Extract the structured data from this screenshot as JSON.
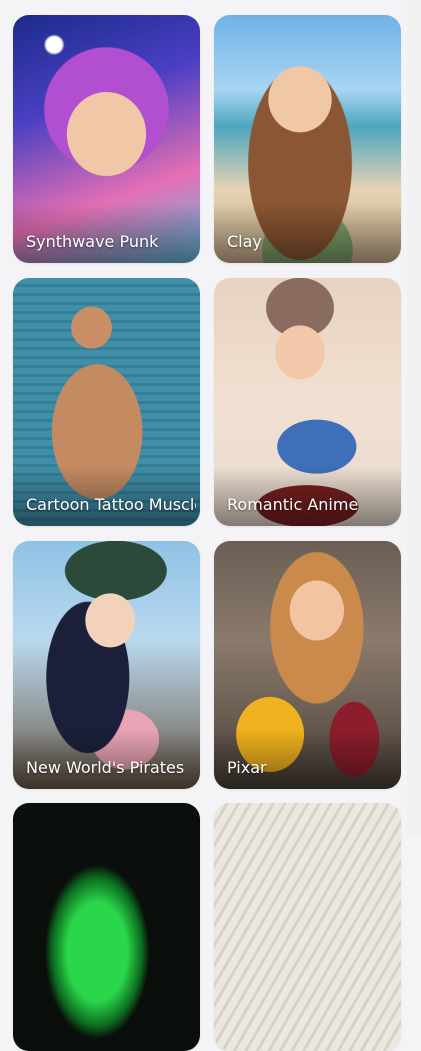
{
  "cards": [
    {
      "label": "Synthwave Punk"
    },
    {
      "label": "Clay"
    },
    {
      "label": "Cartoon Tattoo Muscle"
    },
    {
      "label": "Romantic Anime"
    },
    {
      "label": "New World's Pirates"
    },
    {
      "label": "Pixar"
    }
  ]
}
